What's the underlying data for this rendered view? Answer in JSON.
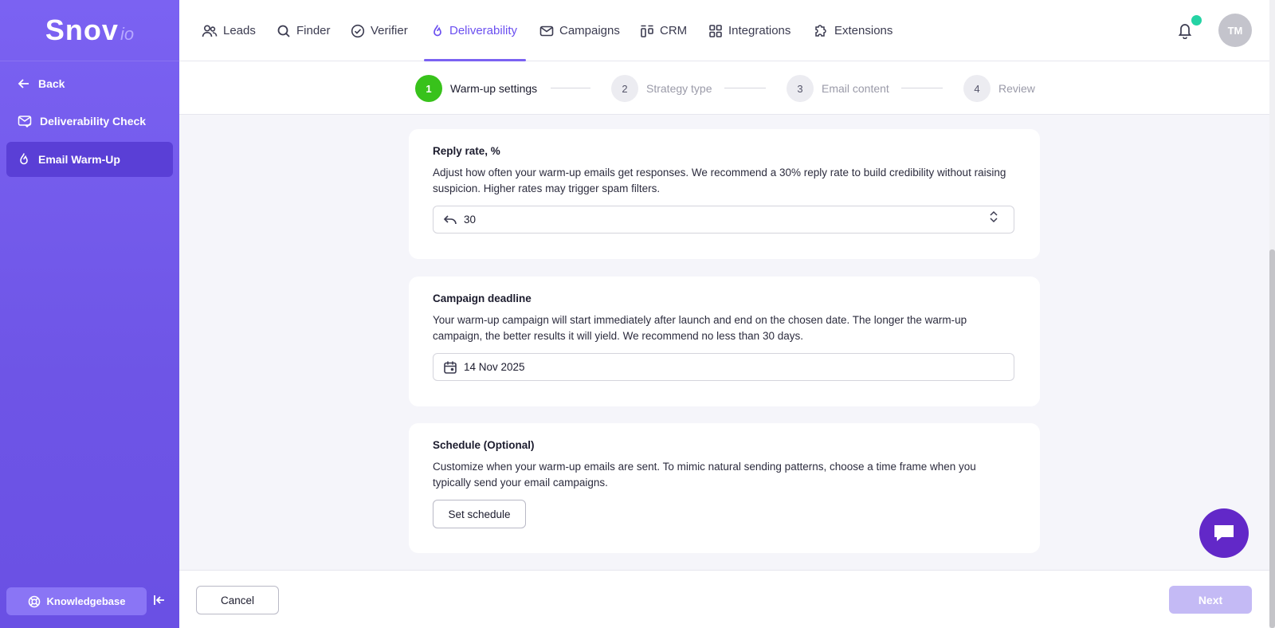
{
  "brand": {
    "name": "Snov",
    "suffix": "io"
  },
  "sidebar": {
    "items": [
      {
        "label": "Back",
        "icon": "arrow-left-icon"
      },
      {
        "label": "Deliverability Check",
        "icon": "envelope-check-icon"
      },
      {
        "label": "Email Warm-Up",
        "icon": "flame-icon",
        "active": true
      }
    ],
    "knowledgebase": "Knowledgebase"
  },
  "nav": {
    "items": [
      {
        "label": "Leads",
        "icon": "users-icon"
      },
      {
        "label": "Finder",
        "icon": "search-icon"
      },
      {
        "label": "Verifier",
        "icon": "check-circle-icon"
      },
      {
        "label": "Deliverability",
        "icon": "flame-icon",
        "active": true
      },
      {
        "label": "Campaigns",
        "icon": "envelope-icon"
      },
      {
        "label": "CRM",
        "icon": "kanban-icon"
      },
      {
        "label": "Integrations",
        "icon": "grid-icon"
      },
      {
        "label": "Extensions",
        "icon": "puzzle-icon"
      }
    ],
    "avatar": "TM"
  },
  "stepper": {
    "steps": [
      {
        "num": "1",
        "label": "Warm-up settings",
        "state": "current"
      },
      {
        "num": "2",
        "label": "Strategy type",
        "state": "pending"
      },
      {
        "num": "3",
        "label": "Email content",
        "state": "pending"
      },
      {
        "num": "4",
        "label": "Review",
        "state": "pending"
      }
    ]
  },
  "reply_rate": {
    "title": "Reply rate, %",
    "description": "Adjust how often your warm-up emails get responses. We recommend a 30% reply rate to build credibility without raising suspicion. Higher rates may trigger spam filters.",
    "value": "30"
  },
  "deadline": {
    "title": "Campaign deadline",
    "description": "Your warm-up campaign will start immediately after launch and end on the chosen date. The longer the warm-up campaign, the better results it will yield. We recommend no less than 30 days.",
    "value": "14 Nov 2025"
  },
  "schedule": {
    "title": "Schedule (Optional)",
    "description": "Customize when your warm-up emails are sent. To mimic natural sending patterns, choose a time frame when you typically send your email campaigns.",
    "button": "Set schedule"
  },
  "footer": {
    "cancel": "Cancel",
    "next": "Next"
  },
  "colors": {
    "accent": "#7b62f2",
    "success": "#38c21b",
    "chat": "#6228c8"
  }
}
